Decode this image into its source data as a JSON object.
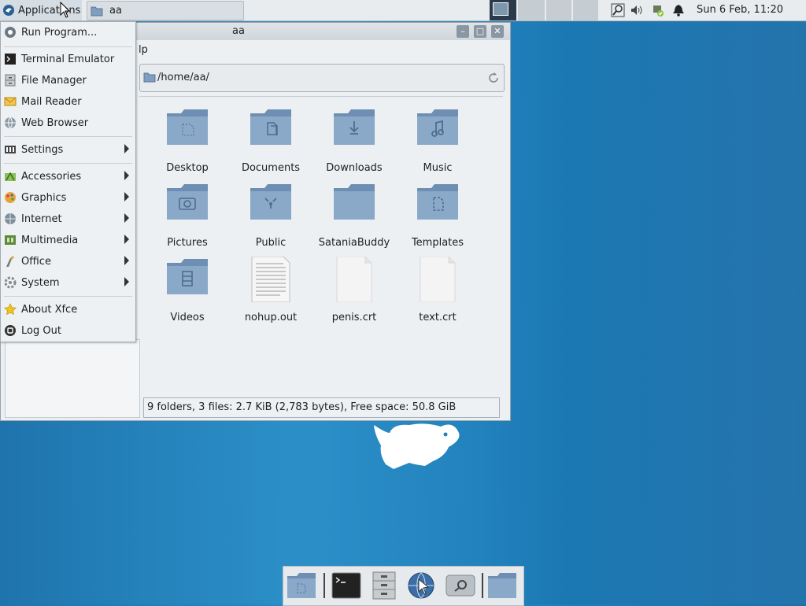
{
  "top_panel": {
    "applications_label": "Applications",
    "task_title": "aa",
    "clock": "Sun  6 Feb, 11:20"
  },
  "window": {
    "title": "aa",
    "menu_fragment": "lp",
    "path": "/home/aa/",
    "status": "9 folders, 3 files: 2.7 KiB (2,783 bytes), Free space: 50.8 GiB",
    "items": [
      {
        "name": "Desktop",
        "kind": "folder"
      },
      {
        "name": "Documents",
        "kind": "folder"
      },
      {
        "name": "Downloads",
        "kind": "folder"
      },
      {
        "name": "Music",
        "kind": "folder"
      },
      {
        "name": "Pictures",
        "kind": "folder"
      },
      {
        "name": "Public",
        "kind": "folder"
      },
      {
        "name": "SataniaBuddy",
        "kind": "folder"
      },
      {
        "name": "Templates",
        "kind": "folder"
      },
      {
        "name": "Videos",
        "kind": "folder"
      },
      {
        "name": "nohup.out",
        "kind": "text-file"
      },
      {
        "name": "penis.crt",
        "kind": "file"
      },
      {
        "name": "text.crt",
        "kind": "file"
      }
    ]
  },
  "app_menu": {
    "items": [
      {
        "label": "Run Program...",
        "icon": "run-icon"
      },
      {
        "label": "Terminal Emulator",
        "icon": "terminal-icon"
      },
      {
        "label": "File Manager",
        "icon": "file-manager-icon"
      },
      {
        "label": "Mail Reader",
        "icon": "mail-icon"
      },
      {
        "label": "Web Browser",
        "icon": "globe-icon"
      },
      {
        "label": "Settings",
        "icon": "settings-icon"
      },
      {
        "label": "Accessories",
        "icon": "accessories-icon"
      },
      {
        "label": "Graphics",
        "icon": "graphics-icon"
      },
      {
        "label": "Internet",
        "icon": "internet-icon"
      },
      {
        "label": "Multimedia",
        "icon": "multimedia-icon"
      },
      {
        "label": "Office",
        "icon": "office-icon"
      },
      {
        "label": "System",
        "icon": "system-icon"
      },
      {
        "label": "About Xfce",
        "icon": "star-icon"
      },
      {
        "label": "Log Out",
        "icon": "logout-icon"
      }
    ]
  },
  "colors": {
    "folder": "#7f9ec0",
    "desktop": "#1f7fbd"
  }
}
